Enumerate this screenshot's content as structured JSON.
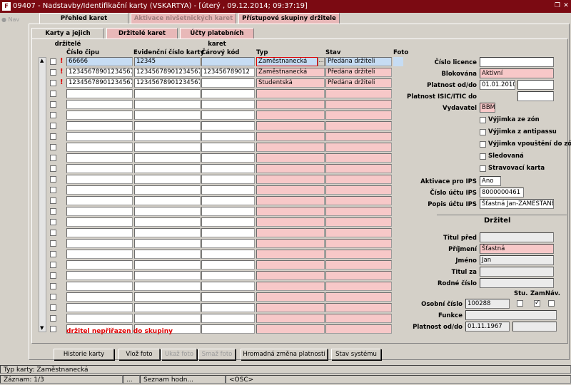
{
  "window": {
    "title": "09407 - Nadstavby/Identifikační karty (VSKARTYA) - [úterý  , 09.12.2014; 09:37:19]",
    "icon": "app-icon",
    "restore_glyph": "❐",
    "close_glyph": "✕"
  },
  "nav": {
    "label": "Nav"
  },
  "main_tabs": [
    {
      "label": "Přehled karet"
    },
    {
      "label": "Aktivace nivšetnických karet"
    },
    {
      "label": "Přístupové skupiny držitele"
    }
  ],
  "sub_tabs": [
    {
      "label": "Karty a jejich držitelé"
    },
    {
      "label": "Držitelé karet"
    },
    {
      "label": "Účty platebních karet"
    }
  ],
  "grid": {
    "headers": {
      "cislo_cipu": "Číslo čipu",
      "evidencni": "Evidenční číslo karty",
      "carovy": "Čárový kód",
      "typ": "Typ",
      "stav": "Stav",
      "foto": "Foto"
    },
    "rows": [
      {
        "cislo_cipu": "66666",
        "evidencni": "12345",
        "carovy": "",
        "typ": "Zaměstnanecká",
        "stav": "Předána držiteli"
      },
      {
        "cislo_cipu": "12345678901234567890",
        "evidencni": "12345678901234567890",
        "carovy": "123456789012",
        "typ": "Zaměstnanecká",
        "stav": "Předána držiteli"
      },
      {
        "cislo_cipu": "12345678901234567890",
        "evidencni": "12345678901234567890",
        "carovy": "",
        "typ": "Studentská",
        "stav": "Předána držiteli"
      }
    ],
    "lov_button": "...",
    "warning_mark": "!",
    "error_message": "držitel nepřiřazen do skupiny"
  },
  "detail": {
    "cislo_licence": {
      "label": "Číslo licence",
      "value": ""
    },
    "blokovana": {
      "label": "Blokována",
      "value": "Aktivní"
    },
    "platnost_od_do": {
      "label": "Platnost od/do",
      "from": "01.01.2010",
      "to": ""
    },
    "platnost_isic": {
      "label": "Platnost ISIC/ITIC do",
      "value": ""
    },
    "vydavatel": {
      "label": "Vydavatel",
      "value": "BBM"
    },
    "checkboxes": [
      {
        "label": "Výjimka ze zón",
        "checked": false
      },
      {
        "label": "Výjimka z antipassu",
        "checked": false
      },
      {
        "label": "Výjimka vpouštění do zón",
        "checked": false
      },
      {
        "label": "Sledovaná",
        "checked": false
      },
      {
        "label": "Stravovací karta",
        "checked": false
      }
    ],
    "aktivace_ips": {
      "label": "Aktivace pro IPS",
      "value": "Ano"
    },
    "cislo_uctu_ips": {
      "label": "Číslo účtu IPS",
      "value": "8000000461"
    },
    "popis_uctu_ips": {
      "label": "Popis účtu IPS",
      "value": "Šťastná Jan-ZAMESTANE"
    }
  },
  "drzitel": {
    "section_title": "Držitel",
    "titul_pred": {
      "label": "Titul před",
      "value": ""
    },
    "prijmeni": {
      "label": "Příjmení",
      "value": "Šťastná"
    },
    "jmeno": {
      "label": "Jméno",
      "value": "Jan"
    },
    "titul_za": {
      "label": "Titul za",
      "value": ""
    },
    "rodne_cislo": {
      "label": "Rodné číslo",
      "value": ""
    },
    "stu_label": "Stu.",
    "zam_label": "Zam.",
    "nav_label": "Náv.",
    "osobni_cislo": {
      "label": "Osobní číslo",
      "value": "100288",
      "stu": false,
      "zam": true,
      "nav": false
    },
    "funkce": {
      "label": "Funkce",
      "value": ""
    },
    "platnost": {
      "label": "Platnost od/do",
      "from": "01.11.1967",
      "to": ""
    }
  },
  "buttons": [
    {
      "label": "Historie karty",
      "enabled": true
    },
    {
      "label": "Vlož foto",
      "enabled": true
    },
    {
      "label": "Ukaž foto",
      "enabled": false
    },
    {
      "label": "Smaž foto",
      "enabled": false
    },
    {
      "label": "Hromadná změna platnosti",
      "enabled": true
    },
    {
      "label": "Stav systému",
      "enabled": true
    }
  ],
  "statusbar": {
    "message": "Typ karty: Zaměstnanecká",
    "record": "Záznam: 1/3",
    "ellipsis": "...",
    "list": "Seznam hodn...",
    "osc": "<OSC>"
  },
  "colors": {
    "titlebar": "#7b0a12",
    "required": "#f7c8c8",
    "selected_row": "#c6dcf3",
    "error": "#d00000"
  }
}
